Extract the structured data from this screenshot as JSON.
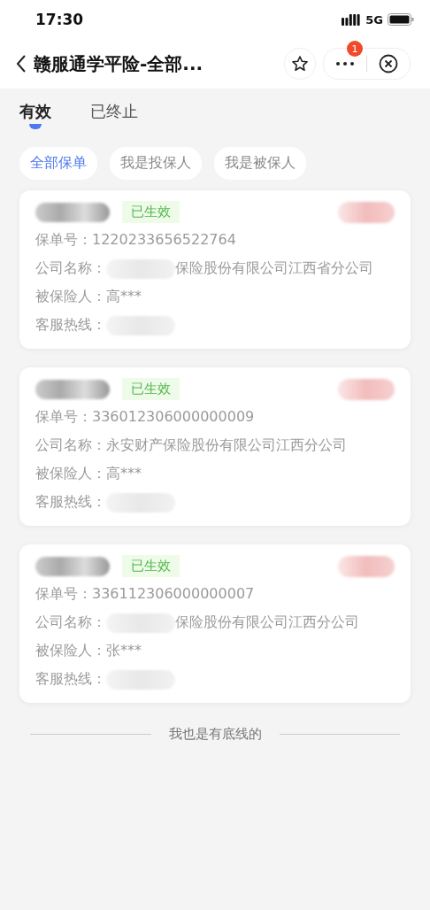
{
  "status_bar": {
    "time": "17:30",
    "network": "5G"
  },
  "nav": {
    "title": "赣服通学平险-全部...",
    "badge": "1"
  },
  "tabs": [
    {
      "label": "有效",
      "selected": true
    },
    {
      "label": "已终止",
      "selected": false
    }
  ],
  "filters": [
    {
      "label": "全部保单",
      "selected": true
    },
    {
      "label": "我是投保人",
      "selected": false
    },
    {
      "label": "我是被保人",
      "selected": false
    }
  ],
  "policies": [
    {
      "status": "已生效",
      "fields": [
        {
          "label": "保单号：",
          "value": "1220233656522764",
          "redacted": false
        },
        {
          "label": "公司名称：",
          "value": "保险股份有限公司江西省分公司",
          "redacted": true
        },
        {
          "label": "被保险人：",
          "value": "高***",
          "redacted": false
        },
        {
          "label": "客服热线：",
          "redacted": true
        }
      ]
    },
    {
      "status": "已生效",
      "fields": [
        {
          "label": "保单号：",
          "value": "336012306000000009",
          "redacted": false
        },
        {
          "label": "公司名称：",
          "value": "永安财产保险股份有限公司江西分公司",
          "redacted": false
        },
        {
          "label": "被保险人：",
          "value": "高***",
          "redacted": false
        },
        {
          "label": "客服热线：",
          "redacted": true
        }
      ]
    },
    {
      "status": "已生效",
      "fields": [
        {
          "label": "保单号：",
          "value": "336112306000000007",
          "redacted": false
        },
        {
          "label": "公司名称：",
          "value": "保险股份有限公司江西分公司",
          "redacted": true
        },
        {
          "label": "被保险人：",
          "value": "张***",
          "redacted": false
        },
        {
          "label": "客服热线：",
          "redacted": true
        }
      ]
    }
  ],
  "footer": "我也是有底线的"
}
